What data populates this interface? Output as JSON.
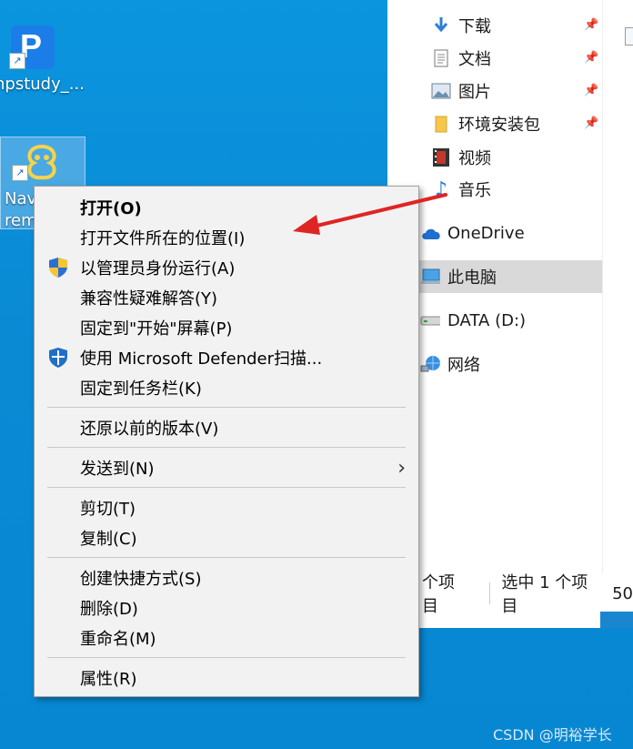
{
  "desktop": {
    "icons": [
      {
        "label": "hpstudy_..."
      },
      {
        "label_line1": "Nav",
        "label_line2": "remiu"
      }
    ]
  },
  "explorer": {
    "nav": [
      {
        "label": "下载",
        "icon": "download-arrow-icon",
        "pinned": true
      },
      {
        "label": "文档",
        "icon": "document-icon",
        "pinned": true
      },
      {
        "label": "图片",
        "icon": "pictures-icon",
        "pinned": true
      },
      {
        "label": "环境安装包",
        "icon": "folder-icon",
        "pinned": true
      },
      {
        "label": "视频",
        "icon": "video-icon",
        "pinned": false
      },
      {
        "label": "音乐",
        "icon": "music-note-icon",
        "pinned": false
      },
      {
        "label": "OneDrive",
        "icon": "cloud-icon"
      },
      {
        "label": "此电脑",
        "icon": "computer-icon",
        "selected": true
      },
      {
        "label": "DATA (D:)",
        "icon": "drive-icon"
      },
      {
        "label": "网络",
        "icon": "network-icon"
      }
    ],
    "status": {
      "items": "个项目",
      "selected": "选中 1 个项目",
      "size": "50"
    }
  },
  "context_menu": {
    "items": [
      {
        "label": "打开(O)",
        "bold": true
      },
      {
        "label": "打开文件所在的位置(I)"
      },
      {
        "label": "以管理员身份运行(A)",
        "icon": "uac-shield-icon"
      },
      {
        "label": "兼容性疑难解答(Y)"
      },
      {
        "label": "固定到\"开始\"屏幕(P)"
      },
      {
        "label": "使用 Microsoft Defender扫描...",
        "icon": "defender-shield-icon"
      },
      {
        "label": "固定到任务栏(K)"
      },
      {
        "label": "还原以前的版本(V)"
      },
      {
        "label": "发送到(N)",
        "submenu": true
      },
      {
        "label": "剪切(T)"
      },
      {
        "label": "复制(C)"
      },
      {
        "label": "创建快捷方式(S)"
      },
      {
        "label": "删除(D)"
      },
      {
        "label": "重命名(M)"
      },
      {
        "label": "属性(R)"
      }
    ]
  },
  "watermark": "CSDN @明裕学长",
  "colors": {
    "desktop": "#0a8fd6",
    "annotation_arrow": "#e02424",
    "menu_bg": "#f2f2f2"
  }
}
